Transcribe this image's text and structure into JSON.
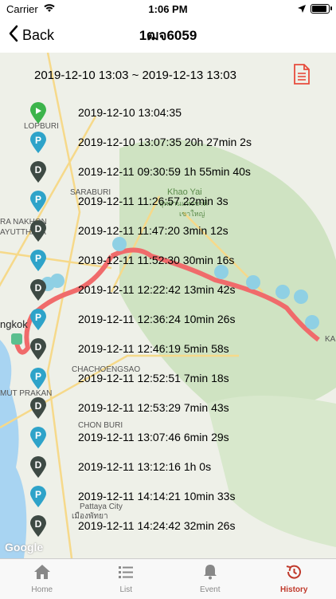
{
  "status": {
    "carrier": "Carrier",
    "time": "1:06 PM"
  },
  "nav": {
    "back_label": "Back",
    "title": "1ฒจ6059"
  },
  "date_range": "2019-12-10 13:03 ~ 2019-12-13 13:03",
  "map_labels": [
    "LOPBURI",
    "SARABURI",
    "Khao Yai",
    "อุทยานแห่งชาติ",
    "เขาใหญ่",
    "RA NAKHON",
    "AYUTTHAYA",
    "ngkok",
    "CHACHOENGSAO",
    "MUT PRAKAN",
    "CHON BURI",
    "Pattaya City",
    "เมืองพัทยา",
    "KA"
  ],
  "events": [
    {
      "type": "start",
      "text": "2019-12-10 13:04:35",
      "color": "#3cb44b"
    },
    {
      "type": "P",
      "text": "2019-12-10 13:07:35  20h 27min 2s",
      "color": "#2ea3c9"
    },
    {
      "type": "D",
      "text": "2019-12-11 09:30:59  1h 55min 40s",
      "color": "#3e4a44"
    },
    {
      "type": "P",
      "text": "2019-12-11 11:26:57  22min 3s",
      "color": "#2ea3c9"
    },
    {
      "type": "D",
      "text": "2019-12-11 11:47:20  3min 12s",
      "color": "#3e4a44"
    },
    {
      "type": "P",
      "text": "2019-12-11 11:52:30  30min 16s",
      "color": "#2ea3c9"
    },
    {
      "type": "D",
      "text": "2019-12-11 12:22:42  13min 42s",
      "color": "#3e4a44"
    },
    {
      "type": "P",
      "text": "2019-12-11 12:36:24  10min 26s",
      "color": "#2ea3c9"
    },
    {
      "type": "D",
      "text": "2019-12-11 12:46:19  5min 58s",
      "color": "#3e4a44"
    },
    {
      "type": "P",
      "text": "2019-12-11 12:52:51  7min 18s",
      "color": "#2ea3c9"
    },
    {
      "type": "D",
      "text": "2019-12-11 12:53:29  7min 43s",
      "color": "#3e4a44"
    },
    {
      "type": "P",
      "text": "2019-12-11 13:07:46  6min 29s",
      "color": "#2ea3c9"
    },
    {
      "type": "D",
      "text": "2019-12-11 13:12:16  1h 0s",
      "color": "#3e4a44"
    },
    {
      "type": "P",
      "text": "2019-12-11 14:14:21  10min 33s",
      "color": "#2ea3c9"
    },
    {
      "type": "D",
      "text": "2019-12-11 14:24:42  32min 26s",
      "color": "#3e4a44"
    }
  ],
  "google": "Google",
  "tabs": [
    {
      "label": "Home",
      "icon": "home-icon"
    },
    {
      "label": "List",
      "icon": "list-icon"
    },
    {
      "label": "Event",
      "icon": "bell-icon"
    },
    {
      "label": "History",
      "icon": "history-icon"
    }
  ],
  "colors": {
    "accent": "#c0392b",
    "route": "#f06b6b",
    "parking": "#2ea3c9",
    "driving": "#3e4a44",
    "start": "#3cb44b"
  }
}
